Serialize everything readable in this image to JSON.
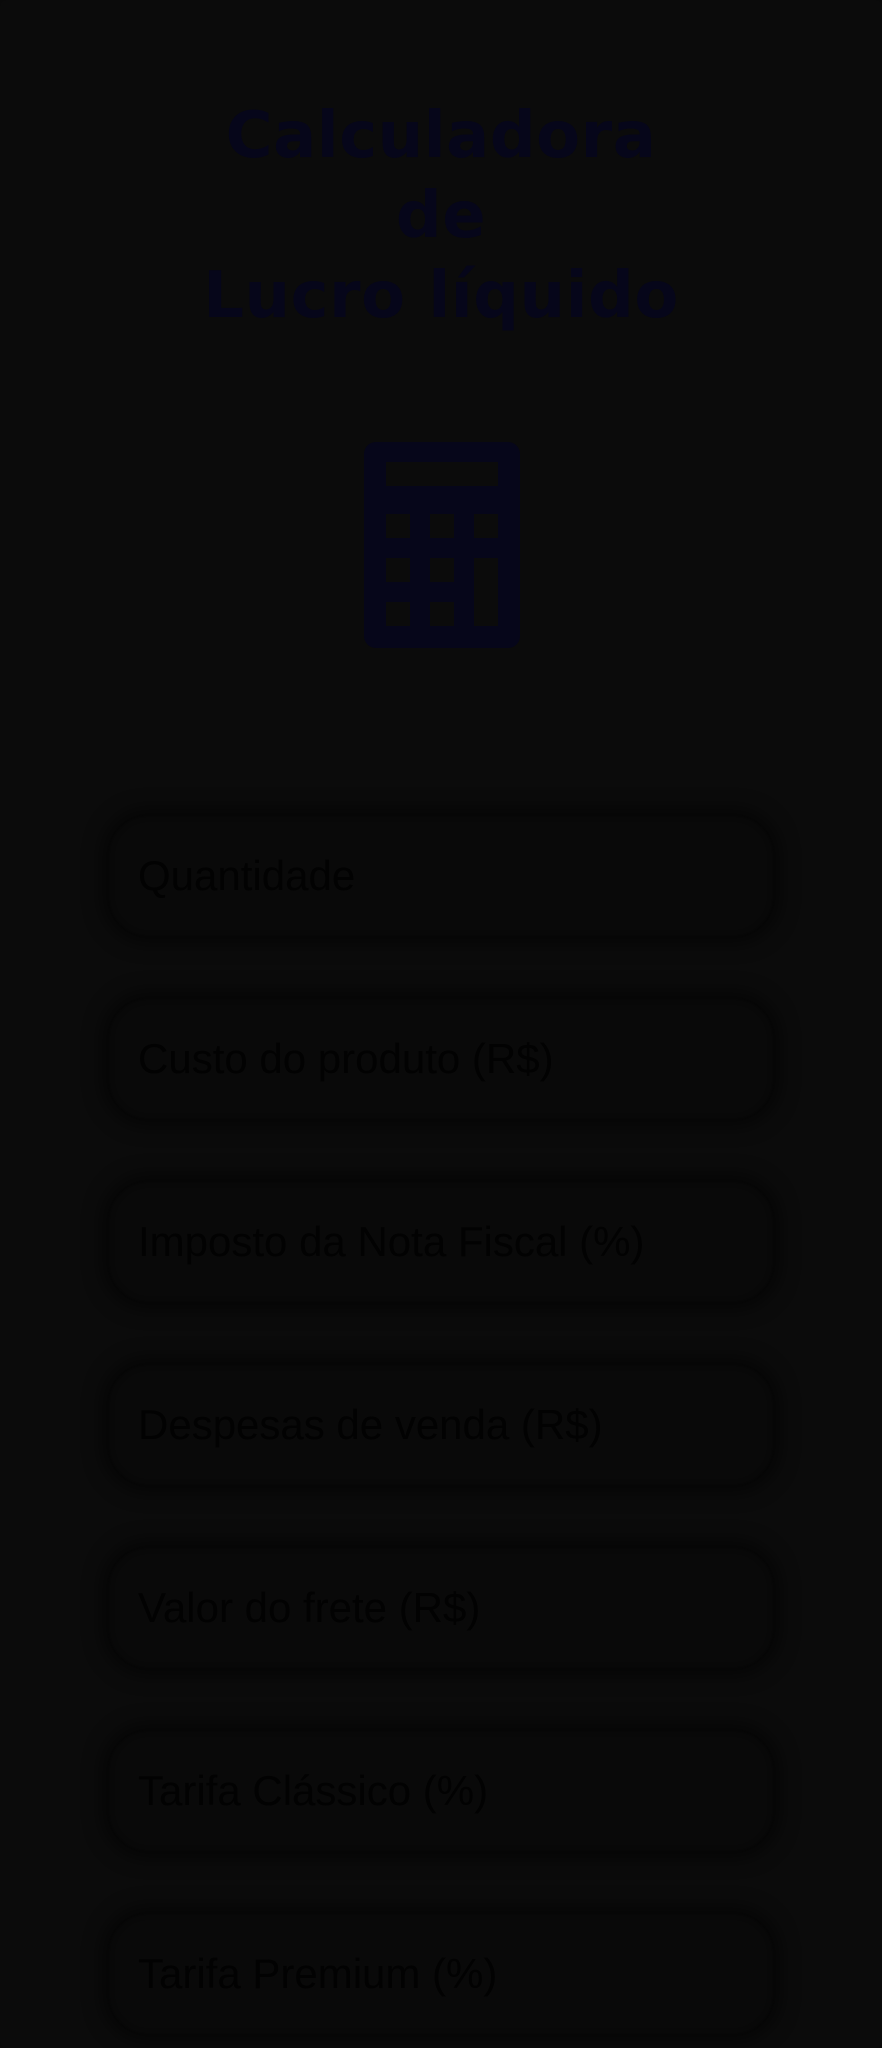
{
  "header": {
    "title_line1": "Calculadora",
    "title_line2": "de",
    "title_line3": "Lucro líquido"
  },
  "icon": {
    "name": "calculator-icon",
    "color": "#06061a"
  },
  "form": {
    "fields": [
      {
        "placeholder": "Quantidade",
        "value": ""
      },
      {
        "placeholder": "Custo do produto (R$)",
        "value": ""
      },
      {
        "placeholder": "Imposto da Nota Fiscal (%)",
        "value": ""
      },
      {
        "placeholder": "Despesas de venda (R$)",
        "value": ""
      },
      {
        "placeholder": "Valor do frete (R$)",
        "value": ""
      },
      {
        "placeholder": "Tarifa Clássico (%)",
        "value": ""
      },
      {
        "placeholder": "Tarifa Premium (%)",
        "value": ""
      }
    ]
  },
  "colors": {
    "background": "#0b0b0b",
    "title": "#06061a",
    "field_background": "#090909"
  }
}
